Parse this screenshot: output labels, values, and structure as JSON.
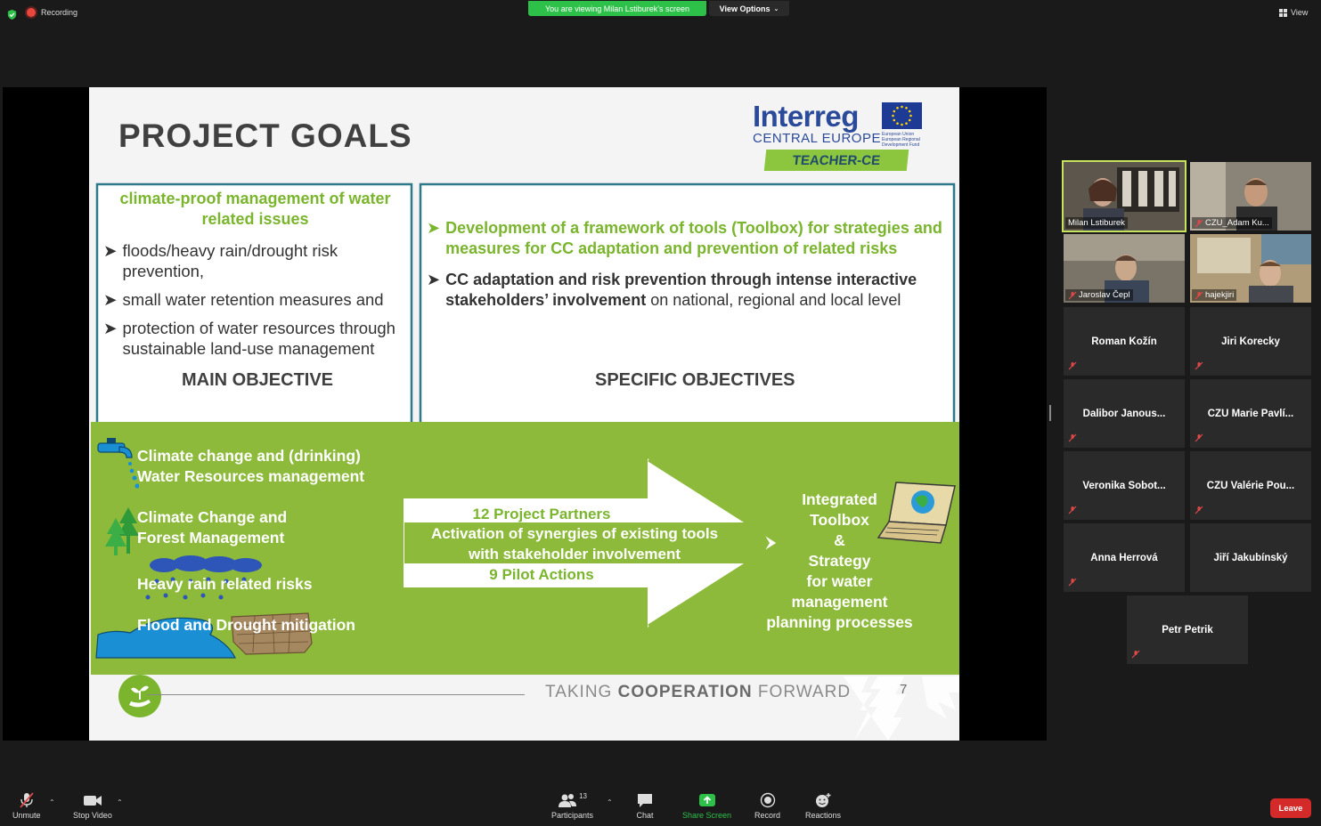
{
  "topbar": {
    "recording": "Recording",
    "viewing_banner": "You are viewing Milan Lstiburek's screen",
    "view_options": "View Options",
    "view": "View"
  },
  "slide": {
    "title": "PROJECT GOALS",
    "logo": {
      "word": "Interreg",
      "sub": "CENTRAL EUROPE",
      "eu": "European Union European Regional Development Fund",
      "badge": "TEACHER-CE"
    },
    "main": {
      "heading": [
        "climate-proof management of water",
        "related  issues"
      ],
      "bullets": [
        [
          "floods/heavy rain/drought risk",
          "prevention,"
        ],
        [
          "small water retention measures and"
        ],
        [
          "protection of water resources through",
          "sustainable land-use management"
        ]
      ],
      "label": "MAIN OBJECTIVE"
    },
    "specific": {
      "bullet1": [
        "Development of a framework of tools (Toolbox) for strategies and",
        "measures for CC adaptation and prevention of related risks"
      ],
      "bullet2_bold_1": "CC adaptation and risk prevention through intense interactive",
      "bullet2_bold_2": "stakeholders’ involvement",
      "bullet2_rest": " on national, regional and local level",
      "label": "SPECIFIC OBJECTIVES"
    },
    "band": {
      "items": [
        [
          "Climate change and (drinking)",
          "Water Resources management"
        ],
        [
          "Climate Change and",
          "Forest Management"
        ],
        [
          "Heavy rain related risks"
        ],
        [
          "Flood and Drought mitigation"
        ]
      ],
      "arrow": {
        "line1": "12 Project Partners",
        "line2": "Activation of synergies of existing tools",
        "line3": "with stakeholder involvement",
        "line4": "9 Pilot Actions"
      },
      "result": [
        "Integrated",
        "Toolbox",
        "&",
        "Strategy",
        "for water",
        "management",
        "planning processes"
      ]
    },
    "footer": {
      "taking": "TAKING ",
      "cooperation": "COOPERATION",
      "forward": " FORWARD",
      "page": "7"
    }
  },
  "participants": {
    "video": [
      {
        "name": "Milan Lstiburek",
        "active": true
      },
      {
        "name": "CZU_Adam Ku..."
      },
      {
        "name": "Jaroslav Čepl"
      },
      {
        "name": "hajekjiri"
      }
    ],
    "named": [
      "Roman Kožín",
      "Jiri Korecky",
      "Dalibor  Janous...",
      "CZU  Marie  Pavlí...",
      "Veronika  Sobot...",
      "CZU  Valérie  Pou...",
      "Anna Herrová",
      "Jiří Jakubínský",
      "Petr Petrik"
    ]
  },
  "toolbar": {
    "unmute": "Unmute",
    "stop_video": "Stop Video",
    "participants": "Participants",
    "participants_count": "13",
    "chat": "Chat",
    "share_screen": "Share Screen",
    "record": "Record",
    "reactions": "Reactions",
    "leave": "Leave"
  },
  "colors": {
    "accent_green": "#2ec14a",
    "slide_green": "#8dba3a",
    "leave_red": "#d42a2a",
    "active_outline": "#c7e35e"
  }
}
